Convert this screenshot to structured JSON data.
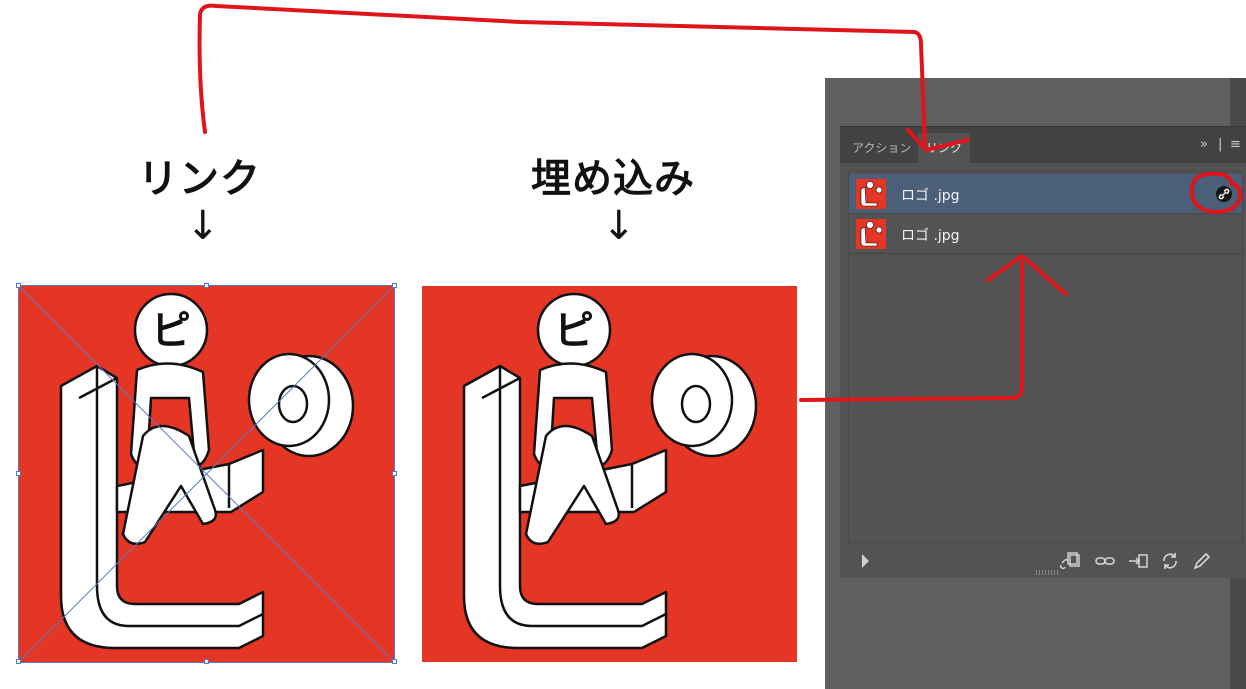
{
  "annotations": {
    "link_heading": "リンク",
    "embed_heading": "埋め込み",
    "down_arrow": "↓",
    "annotation_color": "#e0141b"
  },
  "artwork": {
    "background_color": "#e53524",
    "glyph_text": "ピ"
  },
  "links_panel": {
    "tabs": [
      {
        "label": "アクション",
        "active": false
      },
      {
        "label": "リンク",
        "active": true
      }
    ],
    "expand_label": "»",
    "separator_label": "|",
    "menu_label": "≡",
    "items": [
      {
        "name": "ロゴ .jpg",
        "selected": true,
        "status": "linked",
        "status_icon": "link-icon"
      },
      {
        "name": "ロゴ .jpg",
        "selected": false,
        "status": "embedded",
        "status_icon": ""
      }
    ],
    "footer_tools": [
      "expand-triangle-icon",
      "relink-from-library-icon",
      "relink-icon",
      "go-to-link-icon",
      "update-link-icon",
      "edit-original-icon"
    ]
  }
}
